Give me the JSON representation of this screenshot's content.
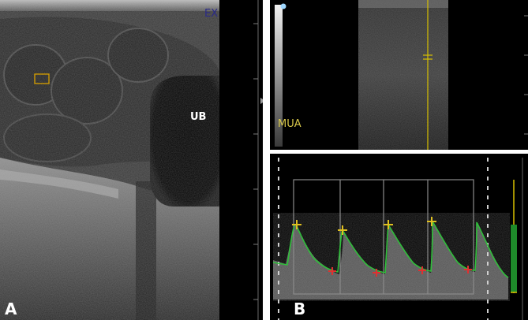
{
  "panelA": {
    "letter": "A",
    "structure_label": "UB",
    "header_fragment": "EX"
  },
  "panelB": {
    "letter": "B",
    "vessel_label": "MUA"
  },
  "colors": {
    "background": "#000000",
    "label": "#ffffff",
    "cursor": "#d8c000",
    "doppler_trace": "#2fbf3a",
    "peak_marker": "#e0c020",
    "trough_marker": "#e03030",
    "grid": "#8a8a8a"
  },
  "doppler_waveform": {
    "cycle_count": 5,
    "peak_markers": 4,
    "trough_markers": 4
  }
}
